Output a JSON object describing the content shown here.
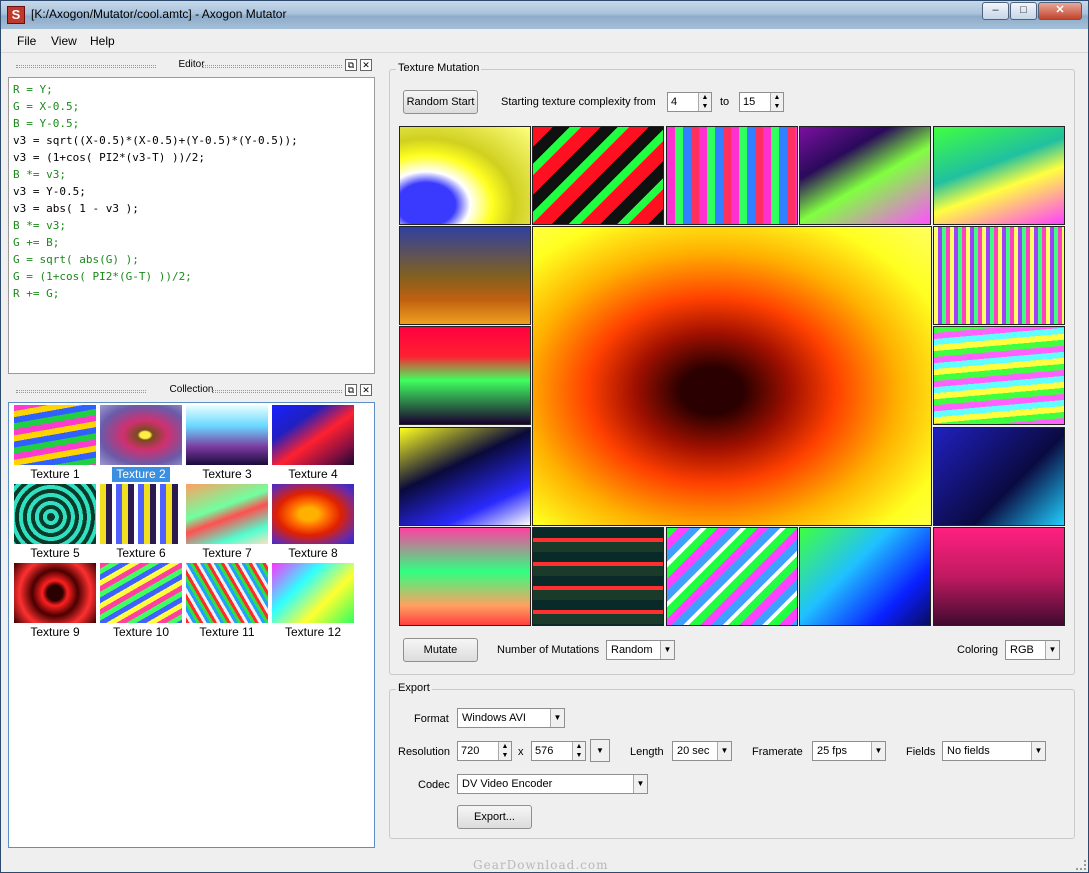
{
  "window": {
    "title": "[K:/Axogon/Mutator/cool.amtc] - Axogon Mutator",
    "icon_letter": "S"
  },
  "menu": [
    "File",
    "View",
    "Help"
  ],
  "editor": {
    "title": "Editor",
    "lines": [
      {
        "text": "R = Y;",
        "color": "green"
      },
      {
        "text": "G = X-0.5;",
        "color": "green"
      },
      {
        "text": "B = Y-0.5;",
        "color": "green"
      },
      {
        "text": "v3 = sqrt((X-0.5)*(X-0.5)+(Y-0.5)*(Y-0.5));",
        "color": "black"
      },
      {
        "text": "v3 = (1+cos( PI2*(v3-T) ))/2;",
        "color": "black"
      },
      {
        "text": "B *= v3;",
        "color": "green"
      },
      {
        "text": "v3 = Y-0.5;",
        "color": "black"
      },
      {
        "text": "v3 = abs( 1 - v3 );",
        "color": "black"
      },
      {
        "text": "B *= v3;",
        "color": "green"
      },
      {
        "text": "G += B;",
        "color": "green"
      },
      {
        "text": "G = sqrt( abs(G) );",
        "color": "green"
      },
      {
        "text": "G = (1+cos( PI2*(G-T) ))/2;",
        "color": "green"
      },
      {
        "text": "R += G;",
        "color": "green"
      }
    ]
  },
  "collection": {
    "title": "Collection",
    "selected_index": 1,
    "items": [
      "Texture 1",
      "Texture 2",
      "Texture 3",
      "Texture 4",
      "Texture 5",
      "Texture 6",
      "Texture 7",
      "Texture 8",
      "Texture 9",
      "Texture 10",
      "Texture 11",
      "Texture 12"
    ]
  },
  "mutation": {
    "group_title": "Texture Mutation",
    "random_start_label": "Random Start",
    "complexity_label": "Starting texture complexity from",
    "complexity_from": "4",
    "to_label": "to",
    "complexity_to": "15",
    "mutate_label": "Mutate",
    "num_mutations_label": "Number of Mutations",
    "num_mutations_value": "Random",
    "coloring_label": "Coloring",
    "coloring_value": "RGB"
  },
  "export": {
    "group_title": "Export",
    "format_label": "Format",
    "format_value": "Windows AVI",
    "resolution_label": "Resolution",
    "res_width": "720",
    "res_x": "x",
    "res_height": "576",
    "length_label": "Length",
    "length_value": "20 sec",
    "framerate_label": "Framerate",
    "framerate_value": "25 fps",
    "fields_label": "Fields",
    "fields_value": "No fields",
    "codec_label": "Codec",
    "codec_value": "DV Video Encoder",
    "export_button": "Export..."
  },
  "watermark": "GearDownload.com"
}
